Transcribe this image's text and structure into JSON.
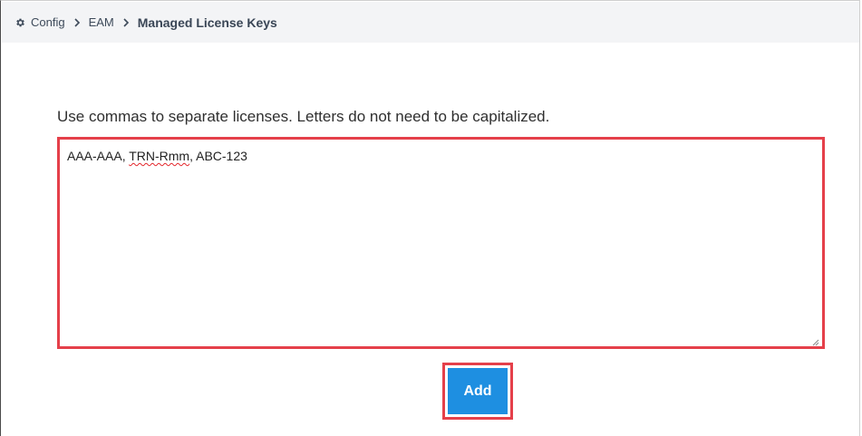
{
  "breadcrumb": {
    "icon": "gear-icon",
    "items": [
      {
        "label": "Config"
      },
      {
        "label": "EAM"
      },
      {
        "label": "Managed License Keys"
      }
    ],
    "separator_icon": "chevron-right-icon"
  },
  "form": {
    "instructions": "Use commas to separate licenses. Letters do not need to be capitalized.",
    "textarea": {
      "value_parts": [
        "AAA-AAA, ",
        "TRN-Rmm",
        ", ABC-123"
      ],
      "placeholder": ""
    },
    "add_label": "Add"
  },
  "colors": {
    "highlight": "#e5404a",
    "button": "#1e8fe1",
    "breadcrumb_bg": "#f3f4f6"
  }
}
